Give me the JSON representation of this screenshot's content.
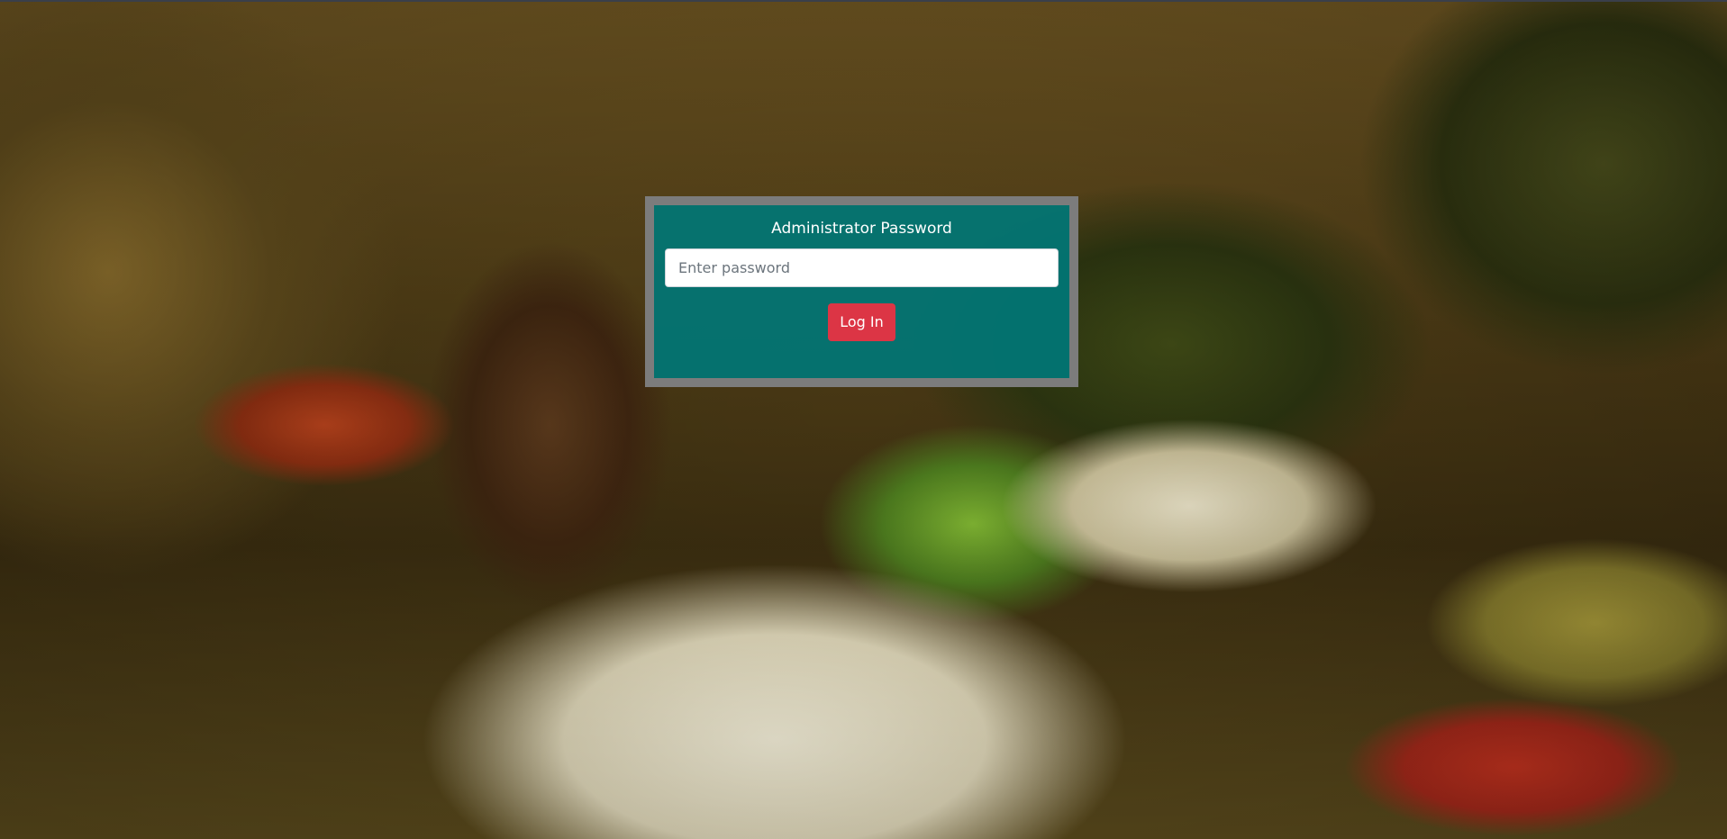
{
  "login": {
    "title": "Administrator Password",
    "password_placeholder": "Enter password",
    "login_label": "Log In"
  },
  "colors": {
    "panel_background": "#007676",
    "panel_border": "#7c7c7c",
    "button_background": "#dc3545"
  },
  "background": {
    "icon": "herbal-spices-mortar-photo"
  }
}
